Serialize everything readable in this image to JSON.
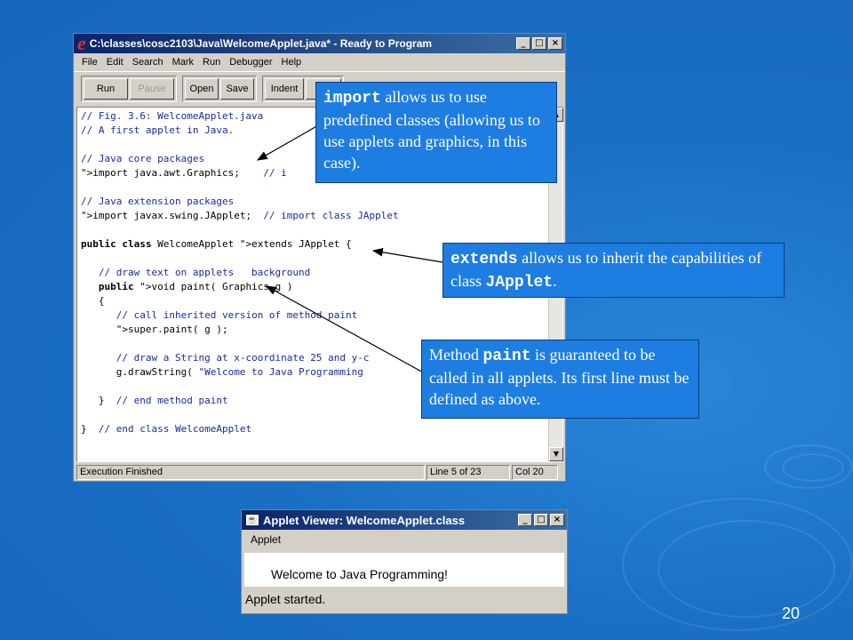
{
  "ide": {
    "title": "C:\\classes\\cosc2103\\Java\\WelcomeApplet.java* - Ready to Program",
    "logo": "e",
    "menu": [
      "File",
      "Edit",
      "Search",
      "Mark",
      "Run",
      "Debugger",
      "Help"
    ],
    "toolbar": {
      "run": "Run",
      "pause": "Pause",
      "open": "Open",
      "save": "Save",
      "indent": "Indent",
      "print": "P"
    },
    "status": {
      "message": "Execution Finished",
      "line": "Line 5 of 23",
      "col": "Col 20"
    }
  },
  "code_lines": [
    "// Fig. 3.6: WelcomeApplet.java",
    "// A first applet in Java.",
    "",
    "// Java core packages",
    "import java.awt.Graphics;    // i",
    "",
    "// Java extension packages",
    "import javax.swing.JApplet;  // import class JApplet",
    "",
    "public class WelcomeApplet extends JApplet {",
    "",
    "   // draw text on applets   background",
    "   public void paint( Graphics g )",
    "   {",
    "      // call inherited version of method paint",
    "      super.paint( g );",
    "",
    "      // draw a String at x-coordinate 25 and y-c",
    "      g.drawString( \"Welcome to Java Programming",
    "",
    "   }  // end method paint",
    "",
    "}  // end class WelcomeApplet"
  ],
  "callouts": {
    "import": {
      "kw": "import",
      "text": " allows us to use predefined classes (allowing us to use applets and graphics, in this case)."
    },
    "extends": {
      "kw": "extends",
      "text1": " allows us to inherit the capabilities of class ",
      "kw2": "JApplet",
      "text2": "."
    },
    "paint": {
      "pre": "Method ",
      "kw": "paint",
      "text": " is guaranteed to be called in all applets.  Its first line must be defined as above."
    }
  },
  "applet_viewer": {
    "title": "Applet Viewer: WelcomeApplet.class",
    "menu": "Applet",
    "message": "Welcome to Java Programming!",
    "status": "Applet started."
  },
  "page_number": "20"
}
